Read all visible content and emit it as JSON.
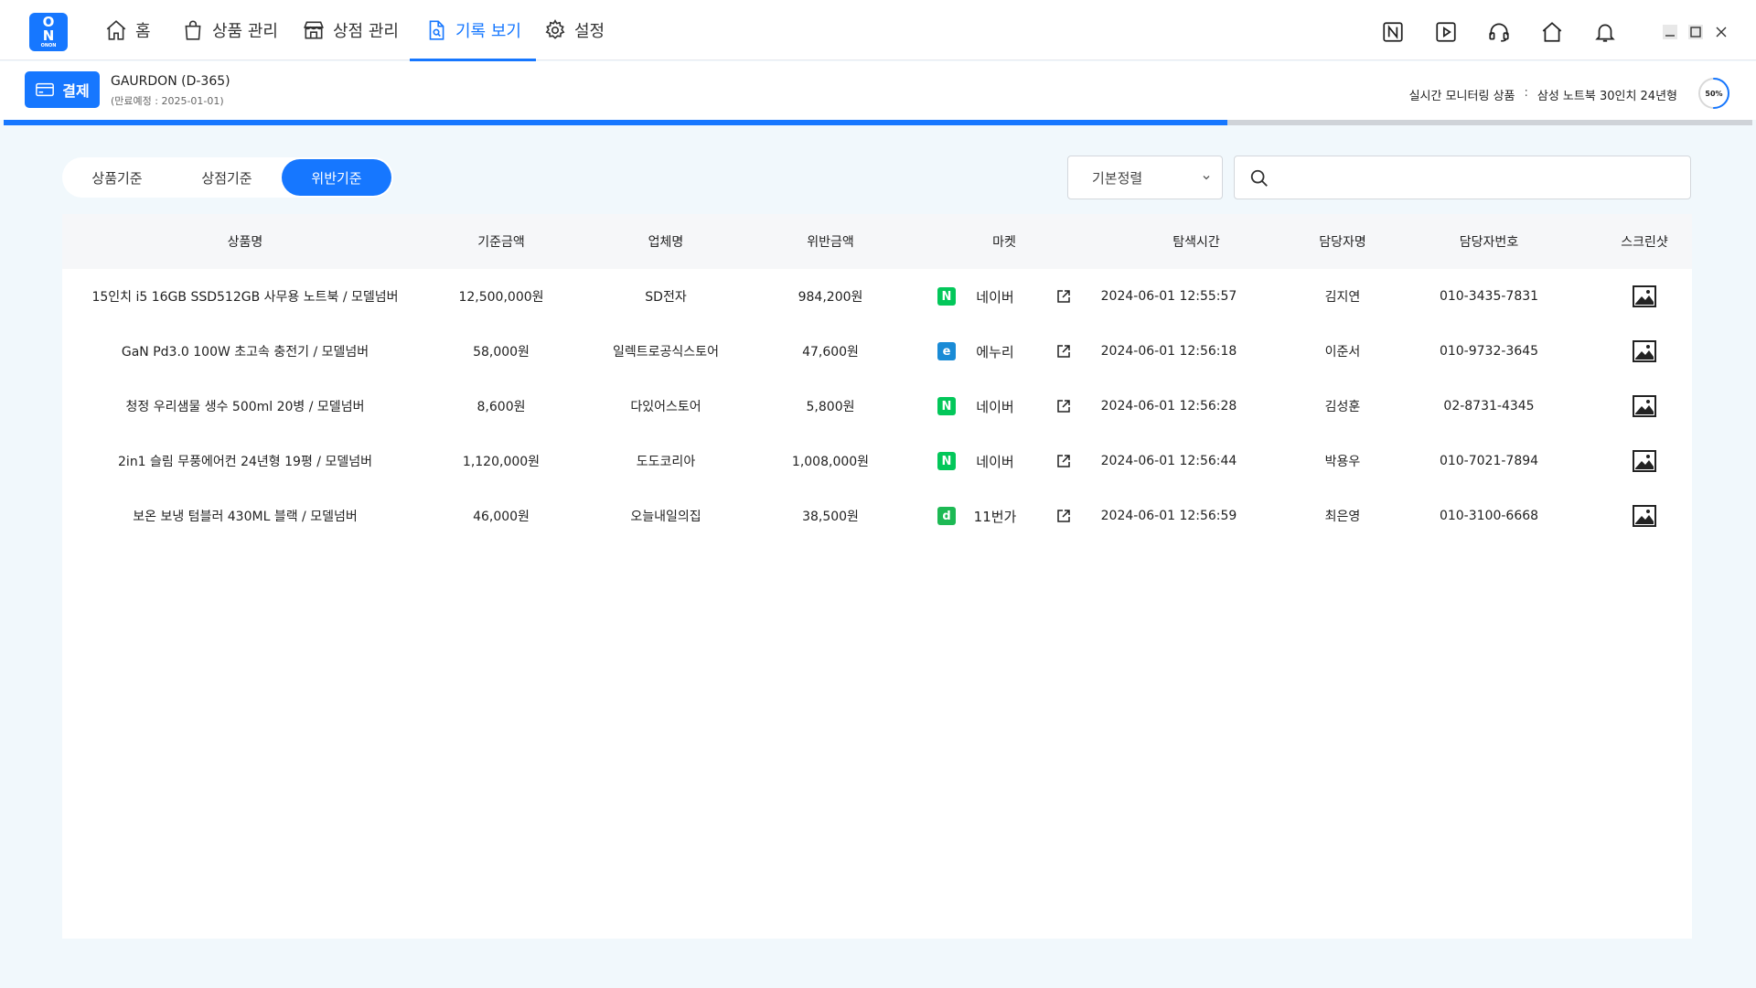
{
  "logo": {
    "line1": "O",
    "line2": "N",
    "line3": "ONON"
  },
  "nav": {
    "items": [
      {
        "label": "홈",
        "icon": "home-outline-icon"
      },
      {
        "label": "상품 관리",
        "icon": "shopping-bag-icon"
      },
      {
        "label": "상점 관리",
        "icon": "store-icon"
      },
      {
        "label": "기록 보기",
        "icon": "document-search-icon",
        "active": true
      },
      {
        "label": "설정",
        "icon": "gear-icon"
      }
    ],
    "right_icons": [
      "naver-n-icon",
      "play-icon",
      "headset-icon",
      "home-icon",
      "bell-icon"
    ],
    "window_buttons": [
      "minimize-icon",
      "maximize-icon",
      "close-icon"
    ]
  },
  "account": {
    "pay_label": "결제",
    "name": "GAURDON (D-365)",
    "expiry": "(만료예정 : 2025-01-01)"
  },
  "monitor": {
    "label": "실시간 모니터링 상품",
    "sep": ":",
    "product": "삼성 노트북 30인치 24년형",
    "percent_text": "50%",
    "percent": 50,
    "progress": 0.7
  },
  "tabs": [
    {
      "label": "상품기준"
    },
    {
      "label": "상점기준"
    },
    {
      "label": "위반기준",
      "active": true
    }
  ],
  "sort": {
    "value": "기본정렬"
  },
  "search": {
    "placeholder": "",
    "value": ""
  },
  "colors": {
    "accent": "#1677ff",
    "naver": "#03c75a",
    "enuri": "#1a8bd6",
    "elevenst": "#1db954"
  },
  "table": {
    "headers": [
      "상품명",
      "기준금액",
      "업체명",
      "위반금액",
      "마켓",
      "탐색시간",
      "담당자명",
      "담당자번호",
      "스크린샷"
    ],
    "rows": [
      {
        "product": "15인치 i5 16GB SSD512GB 사무용 노트북 / 모델넘버",
        "base": "12,500,000원",
        "company": "SD전자",
        "violation": "984,200원",
        "market_badge": "N",
        "market_color": "#03c75a",
        "market": "네이버",
        "time": "2024-06-01 12:55:57",
        "manager": "김지연",
        "phone": "010-3435-7831"
      },
      {
        "product": "GaN Pd3.0 100W 초고속 충전기 / 모델넘버",
        "base": "58,000원",
        "company": "일렉트로공식스토어",
        "violation": "47,600원",
        "market_badge": "e",
        "market_color": "#1a8bd6",
        "market": "에누리",
        "time": "2024-06-01 12:56:18",
        "manager": "이준서",
        "phone": "010-9732-3645"
      },
      {
        "product": "청정 우리샘물 생수 500ml 20병 / 모델넘버",
        "base": "8,600원",
        "company": "다있어스토어",
        "violation": "5,800원",
        "market_badge": "N",
        "market_color": "#03c75a",
        "market": "네이버",
        "time": "2024-06-01 12:56:28",
        "manager": "김성훈",
        "phone": "02-8731-4345"
      },
      {
        "product": "2in1 슬림 무풍에어컨 24년형 19평 / 모델넘버",
        "base": "1,120,000원",
        "company": "도도코리아",
        "violation": "1,008,000원",
        "market_badge": "N",
        "market_color": "#03c75a",
        "market": "네이버",
        "time": "2024-06-01 12:56:44",
        "manager": "박용우",
        "phone": "010-7021-7894"
      },
      {
        "product": "보온 보냉 텀블러 430ML 블랙 / 모델넘버",
        "base": "46,000원",
        "company": "오늘내일의집",
        "violation": "38,500원",
        "market_badge": "d",
        "market_color": "#1db954",
        "market": "11번가",
        "time": "2024-06-01 12:56:59",
        "manager": "최은영",
        "phone": "010-3100-6668"
      }
    ]
  }
}
